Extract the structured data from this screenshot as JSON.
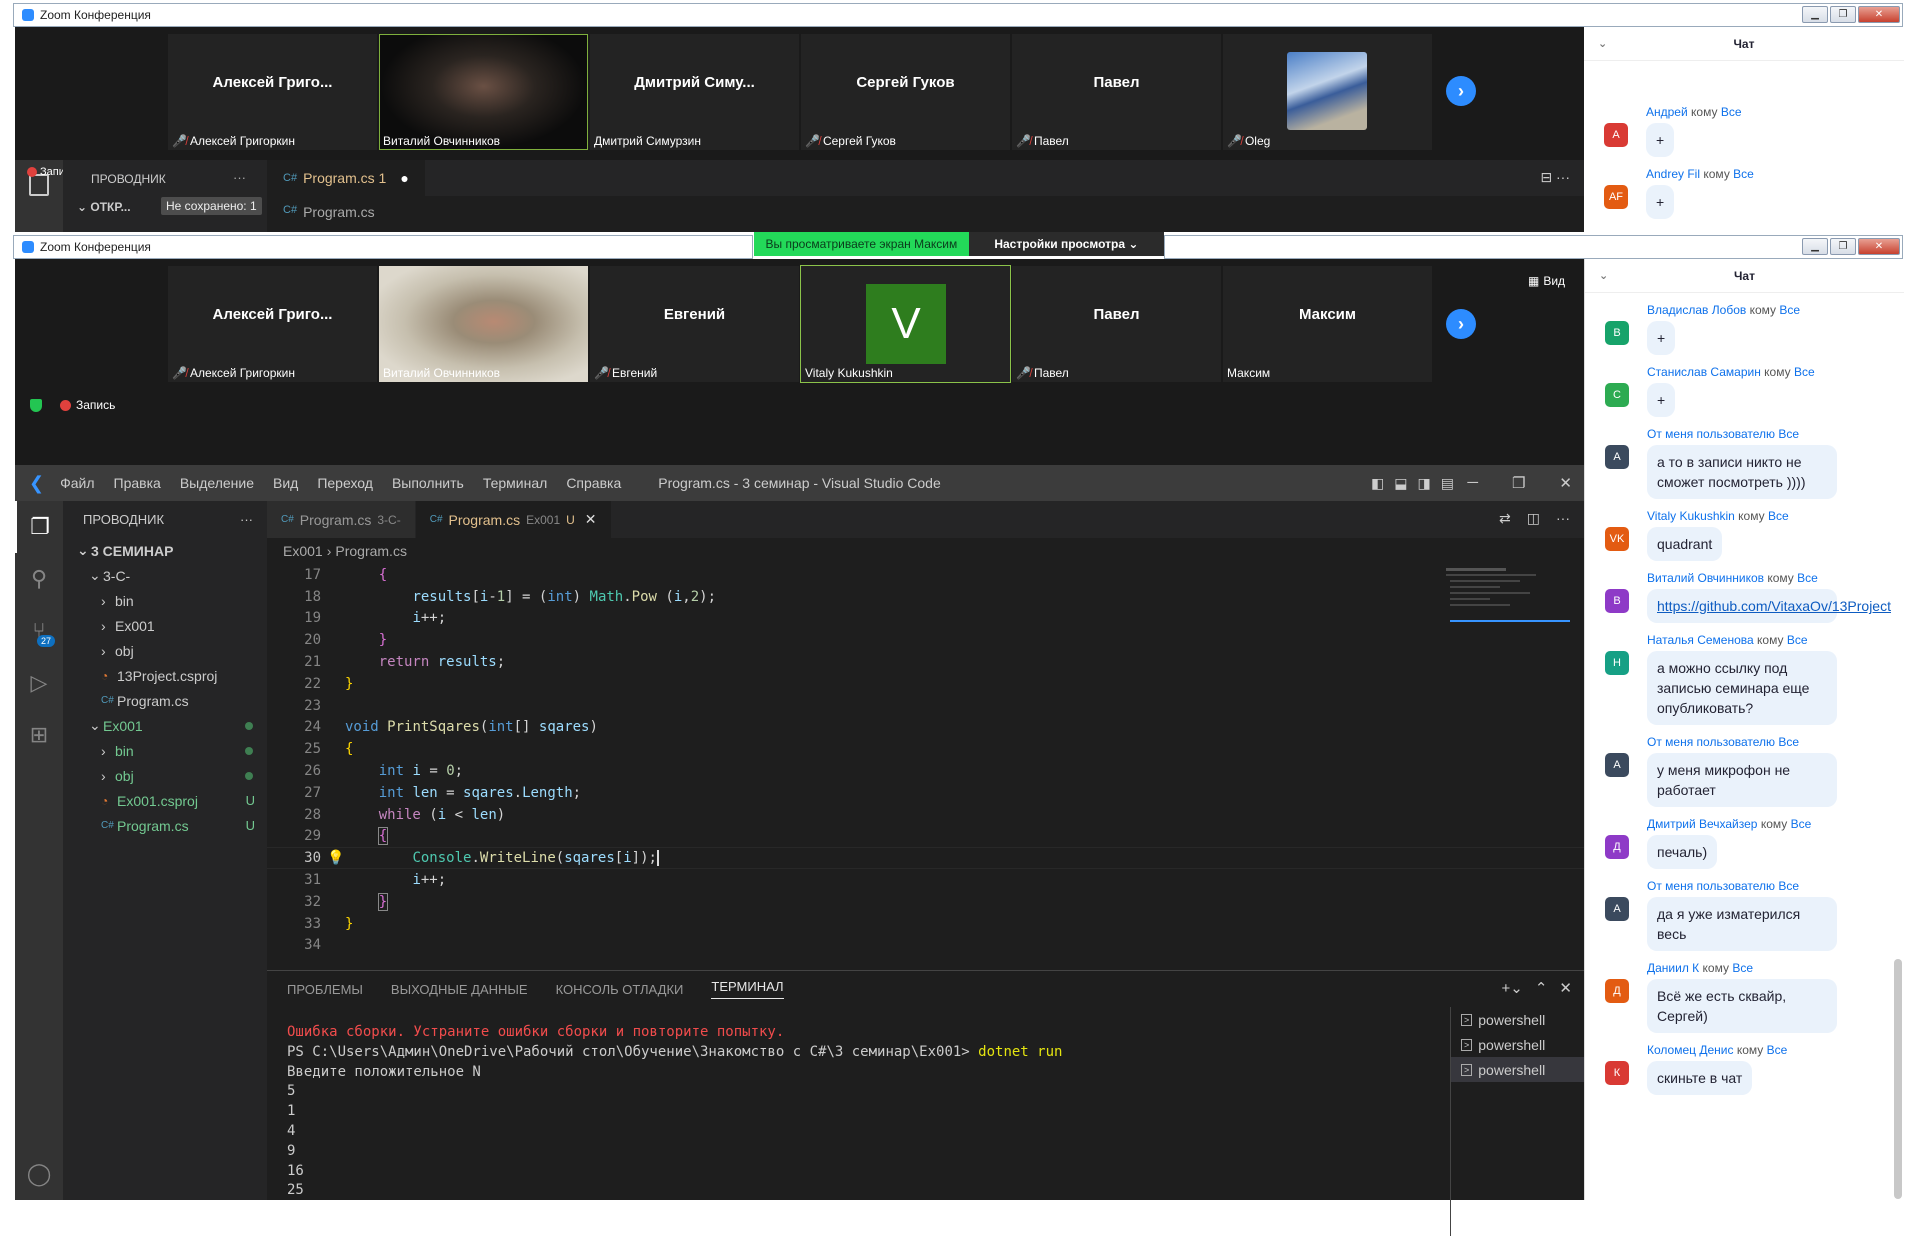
{
  "win1": {
    "title": "Zoom Конференция",
    "participants": [
      {
        "name": "Алексей Григо...",
        "label": "Алексей Григоркин",
        "muted": true
      },
      {
        "name": "",
        "label": "Виталий Овчинников",
        "muted": false
      },
      {
        "name": "Дмитрий Симу...",
        "label": "Дмитрий Симурзин",
        "muted": false
      },
      {
        "name": "Сергей Гуков",
        "label": "Сергей Гуков",
        "muted": true
      },
      {
        "name": "Павел",
        "label": "Павел",
        "muted": true
      },
      {
        "name": "",
        "label": "Oleg",
        "muted": true
      }
    ],
    "recording": "Запись",
    "explorer": "ПРОВОДНИК",
    "open": "ОТКР...",
    "unsaved": "Не сохранено: 1",
    "tab": "Program.cs 1",
    "file": "Program.cs",
    "chat_title": "Чат",
    "chat": [
      {
        "from": "Андрей",
        "to": "кому",
        "all": "Все",
        "avatar": "А",
        "color": "#d93a34",
        "text": "+"
      },
      {
        "from": "Andrey Fil",
        "to": "кому",
        "all": "Все",
        "avatar": "AF",
        "color": "#e35b12",
        "text": "+"
      }
    ]
  },
  "banner": {
    "viewing": "Вы просматриваете экран Максим",
    "options": "Настройки просмотра"
  },
  "win2": {
    "title": "Zoom Конференция",
    "view_btn": "Вид",
    "participants": [
      {
        "name": "Алексей Григо...",
        "label": "Алексей Григоркин",
        "muted": true
      },
      {
        "name": "",
        "label": "Виталий Овчинников",
        "muted": false
      },
      {
        "name": "Евгений",
        "label": "Евгений",
        "muted": true
      },
      {
        "name": "V",
        "label": "Vitaly Kukushkin",
        "muted": false
      },
      {
        "name": "Павел",
        "label": "Павел",
        "muted": true
      },
      {
        "name": "Максим",
        "label": "Максим",
        "muted": false
      }
    ],
    "recording": "Запись",
    "chat_title": "Чат",
    "chat": [
      {
        "from": "Владислав Лобов",
        "to": "кому",
        "all": "Все",
        "avatar": "В",
        "color": "#17a36a",
        "text": "+"
      },
      {
        "from": "Станислав Самарин",
        "to": "кому",
        "all": "Все",
        "avatar": "С",
        "color": "#2dab52",
        "text": "+"
      },
      {
        "from": "От меня пользователю",
        "to": "",
        "all": "Все",
        "avatar": "А",
        "color": "#3b4a5e",
        "text": "а то в записи никто не сможет посмотреть ))))"
      },
      {
        "from": "Vitaly Kukushkin",
        "to": "кому",
        "all": "Все",
        "avatar": "VK",
        "color": "#e35b12",
        "text": "quadrant"
      },
      {
        "from": "Виталий Овчинников",
        "to": "кому",
        "all": "Все",
        "avatar": "В",
        "color": "#8e3ac7",
        "text": "https://github.com/VitaxaOv/13Project",
        "link": true
      },
      {
        "from": "Наталья Семенова",
        "to": "кому",
        "all": "Все",
        "avatar": "Н",
        "color": "#16a085",
        "text": "а можно ссылку под записью семинара еще опубликовать?"
      },
      {
        "from": "От меня пользователю",
        "to": "",
        "all": "Все",
        "avatar": "А",
        "color": "#3b4a5e",
        "text": "у меня микрофон не работает"
      },
      {
        "from": "Дмитрий Вечхайзер",
        "to": "кому",
        "all": "Все",
        "avatar": "Д",
        "color": "#8e3ac7",
        "text": "печаль)"
      },
      {
        "from": "От меня пользователю",
        "to": "",
        "all": "Все",
        "avatar": "А",
        "color": "#3b4a5e",
        "text": "да я уже изматерился весь"
      },
      {
        "from": "Даниил К",
        "to": "кому",
        "all": "Все",
        "avatar": "Д",
        "color": "#e35b12",
        "text": "Всё же есть сквайр, Сергей)"
      },
      {
        "from": "Коломец Денис",
        "to": "кому",
        "all": "Все",
        "avatar": "К",
        "color": "#d93a34",
        "text": "скиньте в чат"
      }
    ]
  },
  "vscode": {
    "menu": [
      "Файл",
      "Правка",
      "Выделение",
      "Вид",
      "Переход",
      "Выполнить",
      "Терминал",
      "Справка"
    ],
    "title": "Program.cs - 3 семинар - Visual Studio Code",
    "explorer": "ПРОВОДНИК",
    "tree": [
      {
        "label": "3 СЕМИНАР",
        "indent": 0,
        "arrow": "⌄",
        "bold": true,
        "color": "#ccc"
      },
      {
        "label": "3-C-",
        "indent": 1,
        "arrow": "⌄",
        "color": "#ccc"
      },
      {
        "label": "bin",
        "indent": 2,
        "arrow": "›",
        "color": "#ccc"
      },
      {
        "label": "Ex001",
        "indent": 2,
        "arrow": "›",
        "color": "#ccc"
      },
      {
        "label": "obj",
        "indent": 2,
        "arrow": "›",
        "color": "#ccc"
      },
      {
        "label": "13Project.csproj",
        "indent": 2,
        "arrow": "",
        "icon": "rss",
        "color": "#ccc"
      },
      {
        "label": "Program.cs",
        "indent": 2,
        "arrow": "",
        "icon": "cs",
        "color": "#ccc"
      },
      {
        "label": "Ex001",
        "indent": 1,
        "arrow": "⌄",
        "color": "#73c991",
        "dot": true
      },
      {
        "label": "bin",
        "indent": 2,
        "arrow": "›",
        "color": "#73c991",
        "dot": true
      },
      {
        "label": "obj",
        "indent": 2,
        "arrow": "›",
        "color": "#73c991",
        "dot": true
      },
      {
        "label": "Ex001.csproj",
        "indent": 2,
        "arrow": "",
        "icon": "rss",
        "color": "#73c991",
        "u": "U"
      },
      {
        "label": "Program.cs",
        "indent": 2,
        "arrow": "",
        "icon": "cs",
        "color": "#73c991",
        "u": "U"
      }
    ],
    "tabs": [
      {
        "label": "Program.cs",
        "sub": "3-C-",
        "active": false
      },
      {
        "label": "Program.cs",
        "sub": "Ex001",
        "mark": "U",
        "active": true
      }
    ],
    "crumbs": [
      "Ex001",
      "Program.cs"
    ],
    "panel_tabs": [
      "ПРОБЛЕМЫ",
      "ВЫХОДНЫЕ ДАННЫЕ",
      "КОНСОЛЬ ОТЛАДКИ",
      "ТЕРМИНАЛ"
    ],
    "terminal": {
      "error": "Ошибка сборки. Устраните ошибки сборки и повторите попытку.",
      "prompt": "PS C:\\Users\\Админ\\OneDrive\\Рабочий стол\\Обучение\\Знакомство с C#\\3 семинар\\Ex001> ",
      "cmd": "dotnet run",
      "lines": [
        "Введите положительное N",
        "5",
        "1",
        "4",
        "9",
        "16",
        "25"
      ]
    },
    "terminals": [
      "powershell",
      "powershell",
      "powershell"
    ],
    "explorer_badge": "27"
  }
}
